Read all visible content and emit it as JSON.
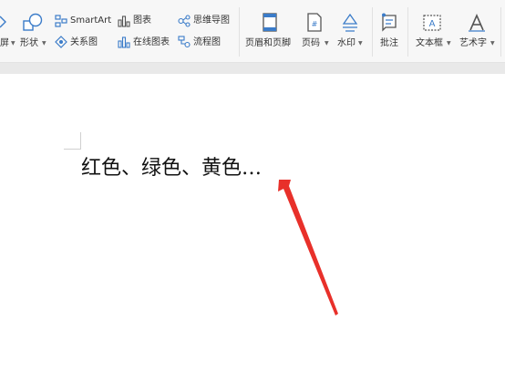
{
  "ribbon": {
    "partial_label": "屏",
    "shapes_label": "形状",
    "relation_label": "关系图",
    "smartart_label": "SmartArt",
    "chart_label": "图表",
    "online_chart_label": "在线图表",
    "mindmap_label": "思维导图",
    "flowchart_label": "流程图",
    "header_footer_label": "页眉和页脚",
    "page_number_label": "页码",
    "watermark_label": "水印",
    "comment_label": "批注",
    "textbox_label": "文本框",
    "wordart_label": "艺术字"
  },
  "document": {
    "text": "红色、绿色、黄色…"
  },
  "colors": {
    "accent_blue": "#3b7cc9",
    "arrow_red": "#e8302a"
  },
  "icons": [
    "shapes-icon",
    "relation-icon",
    "smartart-icon",
    "chart-icon",
    "online-chart-icon",
    "mindmap-icon",
    "flowchart-icon",
    "header-footer-icon",
    "page-number-icon",
    "watermark-icon",
    "comment-icon",
    "textbox-icon",
    "wordart-icon"
  ]
}
